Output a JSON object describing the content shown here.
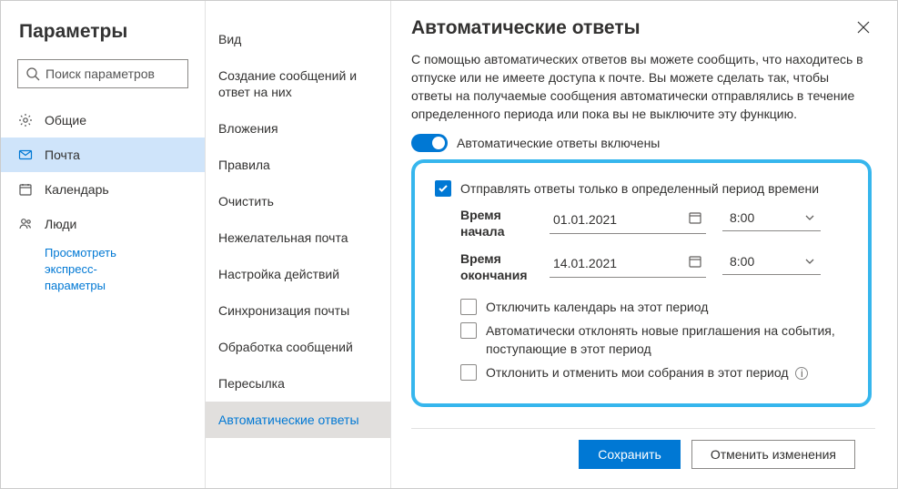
{
  "sidebar": {
    "title": "Параметры",
    "search_placeholder": "Поиск параметров",
    "items": [
      {
        "label": "Общие"
      },
      {
        "label": "Почта"
      },
      {
        "label": "Календарь"
      },
      {
        "label": "Люди"
      }
    ],
    "quick_link_line1": "Просмотреть",
    "quick_link_line2": "экспресс-",
    "quick_link_line3": "параметры"
  },
  "submenu": {
    "items": [
      "Вид",
      "Создание сообщений и ответ на них",
      "Вложения",
      "Правила",
      "Очистить",
      "Нежелательная почта",
      "Настройка действий",
      "Синхронизация почты",
      "Обработка сообщений",
      "Пересылка",
      "Автоматические ответы"
    ]
  },
  "content": {
    "title": "Автоматические ответы",
    "description": "С помощью автоматических ответов вы можете сообщить, что находитесь в отпуске или не имеете доступа к почте. Вы можете сделать так, чтобы ответы на получаемые сообщения автоматически отправлялись в течение определенного периода или пока вы не выключите эту функцию.",
    "toggle_label": "Автоматические ответы включены",
    "send_period_label": "Отправлять ответы только в определенный период времени",
    "start_label": "Время начала",
    "end_label": "Время окончания",
    "start_date": "01.01.2021",
    "start_time": "8:00",
    "end_date": "14.01.2021",
    "end_time": "8:00",
    "optA": "Отключить календарь на этот период",
    "optB": "Автоматически отклонять новые приглашения на события, поступающие в этот период",
    "optC": "Отклонить и отменить мои собрания в этот период"
  },
  "footer": {
    "save": "Сохранить",
    "cancel": "Отменить изменения"
  }
}
